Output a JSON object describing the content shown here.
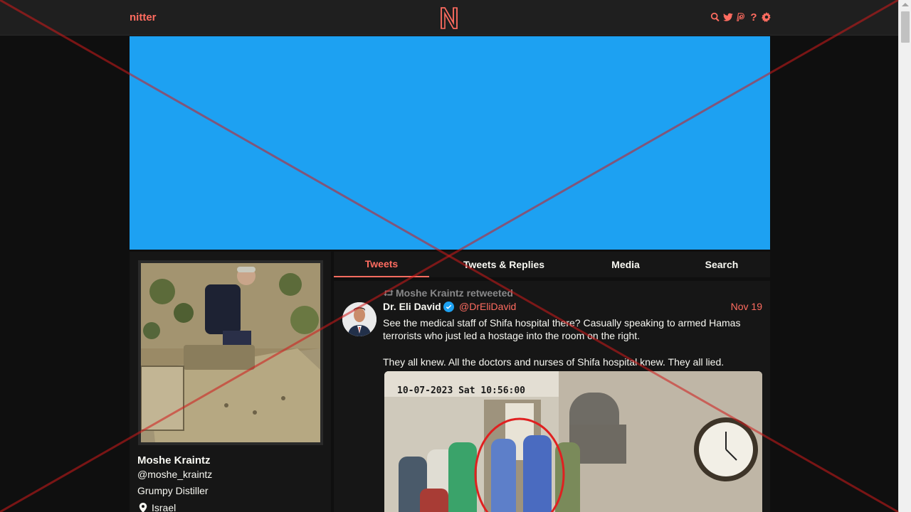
{
  "navbar": {
    "brand": "nitter",
    "logo_letter": "N",
    "icons": [
      "search-icon",
      "twitter-icon",
      "rss-icon",
      "help-icon",
      "gear-icon"
    ],
    "help_glyph": "?"
  },
  "banner": {
    "color": "#1da1f2"
  },
  "profile": {
    "fullname": "Moshe Kraintz",
    "username": "@moshe_kraintz",
    "bio": "Grumpy Distiller",
    "location": "Israel"
  },
  "tabs": [
    {
      "label": "Tweets",
      "active": true
    },
    {
      "label": "Tweets & Replies",
      "active": false
    },
    {
      "label": "Media",
      "active": false
    },
    {
      "label": "Search",
      "active": false
    }
  ],
  "tweet": {
    "retweet_header": "Moshe Kraintz retweeted",
    "fullname": "Dr. Eli David",
    "verified": true,
    "username": "@DrEliDavid",
    "date": "Nov 19",
    "text_1": "See the medical staff of Shifa hospital there? Casually speaking to armed Hamas terrorists who just led a hostage into the room on the right.",
    "text_2": "They all knew. All the doctors and nurses of Shifa hospital knew. They all lied.",
    "media_timestamp": "10-07-2023 Sat 10:56:00"
  },
  "colors": {
    "accent": "#ff6c60",
    "background": "#0f0f0f",
    "panel": "#161616",
    "navbar": "#1f1f1f",
    "text": "#f8f8f2",
    "muted": "#888889"
  }
}
